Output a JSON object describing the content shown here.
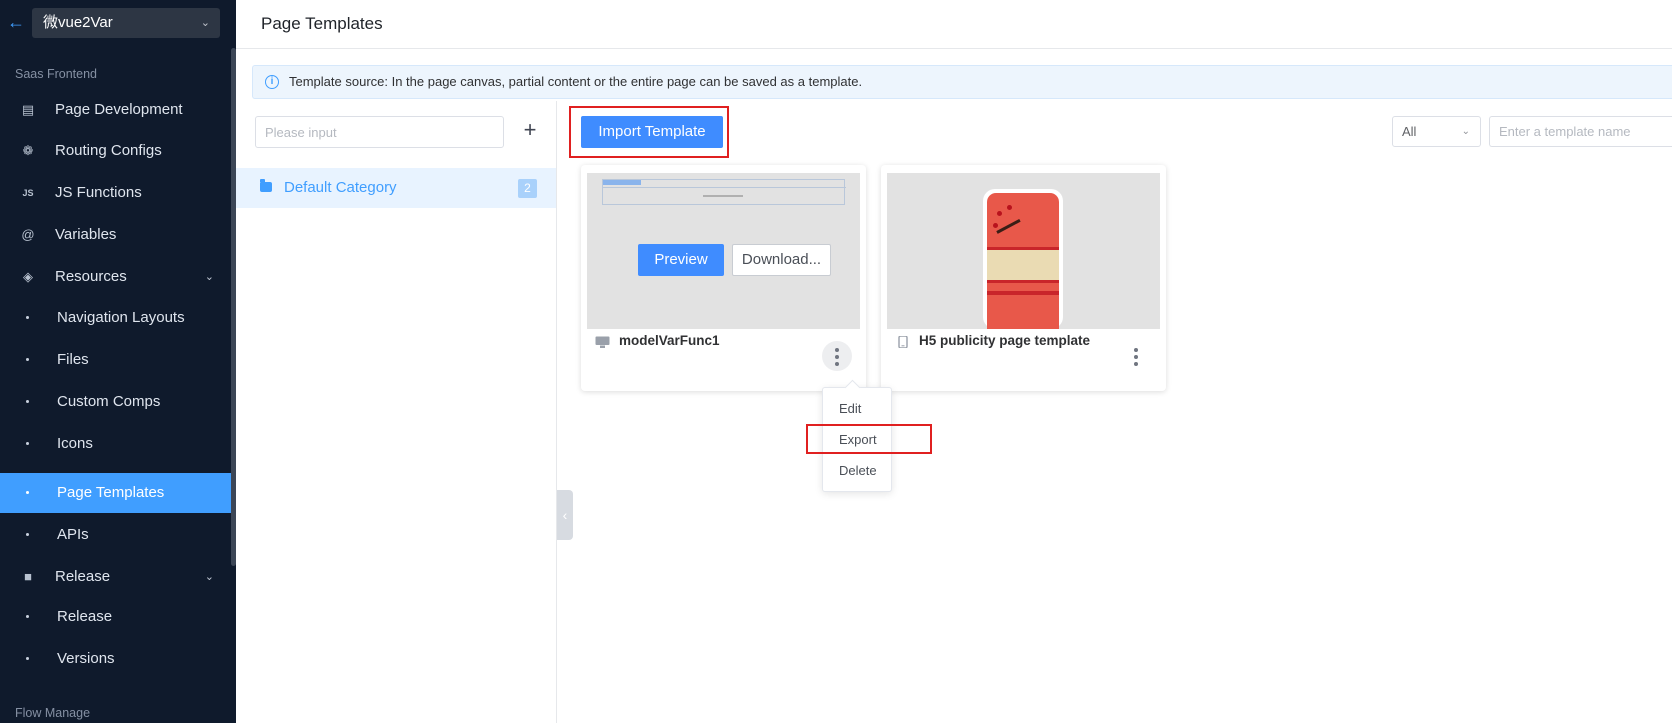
{
  "app": {
    "selector_value": "微vue2Var"
  },
  "sidebar": {
    "groups": [
      "Saas Frontend",
      "Flow Manage"
    ],
    "items": [
      {
        "label": "Page Development",
        "icon": "document-icon"
      },
      {
        "label": "Routing Configs",
        "icon": "routing-icon"
      },
      {
        "label": "JS Functions",
        "icon": "js-icon"
      },
      {
        "label": "Variables",
        "icon": "at-icon"
      },
      {
        "label": "Resources",
        "icon": "layers-icon",
        "expanded": true
      },
      {
        "label": "Navigation Layouts"
      },
      {
        "label": "Files"
      },
      {
        "label": "Custom Comps"
      },
      {
        "label": "Icons"
      },
      {
        "label": "Page Templates",
        "active": true
      },
      {
        "label": "APIs"
      },
      {
        "label": "Release",
        "icon": "box-icon",
        "expanded": true
      },
      {
        "label": "Release"
      },
      {
        "label": "Versions"
      }
    ]
  },
  "header": {
    "title": "Page Templates"
  },
  "banner": {
    "text": "Template source: In the page canvas, partial content or the entire page can be saved as a template."
  },
  "categories": {
    "search_placeholder": "Please input",
    "add_label": "+",
    "items": [
      {
        "label": "Default Category",
        "count": "2"
      }
    ]
  },
  "toolbar": {
    "import_label": "Import Template",
    "type_filter": "All",
    "search_placeholder": "Enter a template name"
  },
  "templates": [
    {
      "name": "modelVarFunc1",
      "device": "desktop",
      "preview_label": "Preview",
      "download_label": "Download..."
    },
    {
      "name": "H5 publicity page template",
      "device": "mobile"
    }
  ],
  "context_menu": {
    "items": [
      "Edit",
      "Export",
      "Delete"
    ]
  },
  "colors": {
    "accent": "#409eff",
    "sidebar_bg": "#0f1a2c",
    "highlight": "#e02020"
  }
}
